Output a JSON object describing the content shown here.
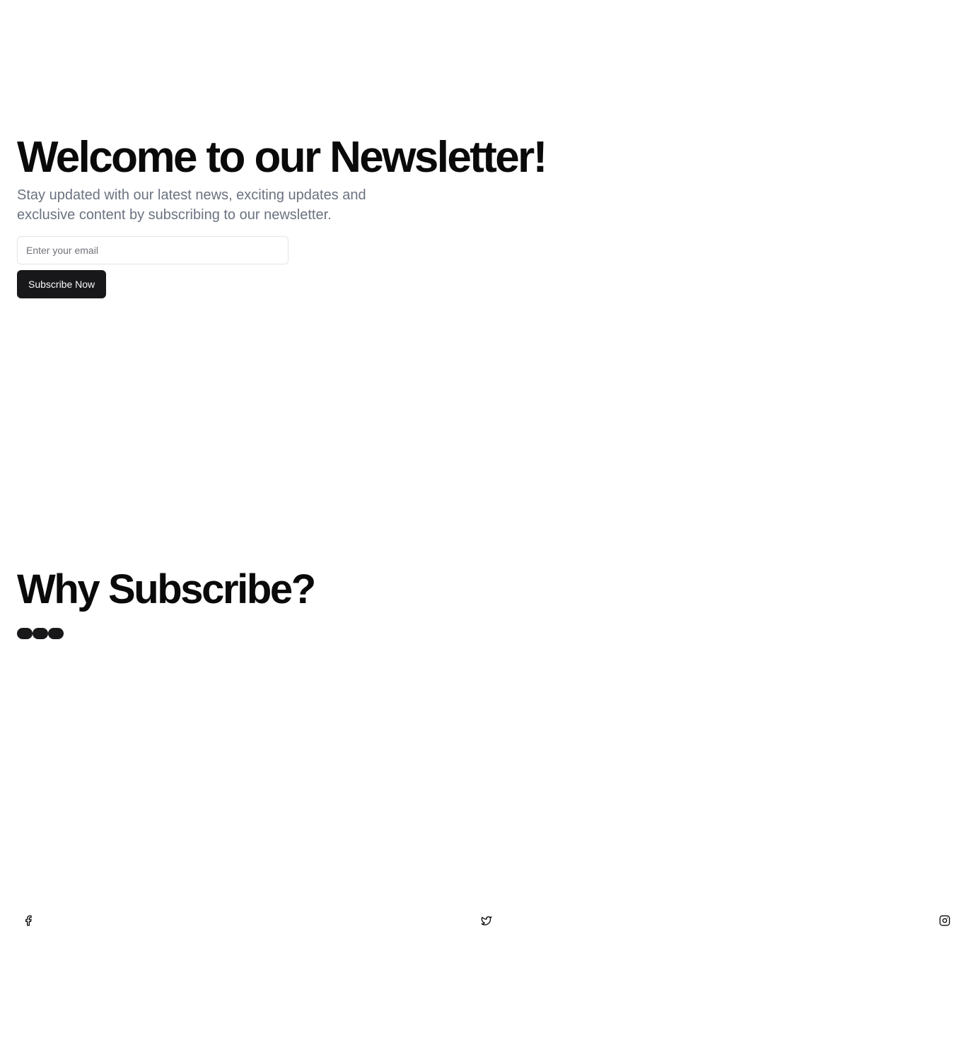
{
  "hero": {
    "title": "Welcome to our Newsletter!",
    "subtitle": "Stay updated with our latest news, exciting updates and exclusive content by subscribing to our newsletter.",
    "email_placeholder": "Enter your email",
    "email_value": "",
    "subscribe_label": "Subscribe Now"
  },
  "why": {
    "title": "Why Subscribe?",
    "dots_count": 3
  },
  "social": [
    {
      "icon": "facebook-icon"
    },
    {
      "icon": "twitter-icon"
    },
    {
      "icon": "instagram-icon"
    }
  ],
  "colors": {
    "text": "#0a0a0a",
    "muted": "#6b7280",
    "button_bg": "#18181b",
    "border": "#e4e4e7"
  }
}
